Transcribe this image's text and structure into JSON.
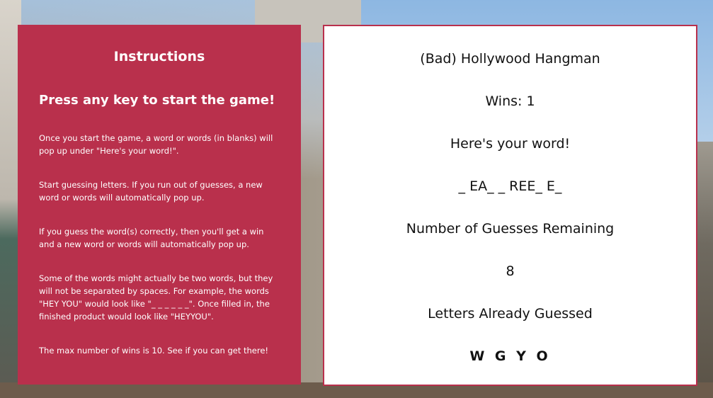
{
  "instructions": {
    "title": "Instructions",
    "start_prompt": "Press any key to start the game!",
    "paragraphs": [
      "Once you start the game, a word or words (in blanks) will pop up under \"Here's your word!\".",
      "Start guessing letters. If you run out of guesses, a new word or words will automatically pop up.",
      "If you guess the word(s) correctly, then you'll get a win and a new word or words will automatically pop up.",
      "Some of the words might actually be two words, but they will not be separated by spaces. For example, the words \"HEY YOU\" would look like \"_ _ _ _ _ _\". Once filled in, the finished product would look like \"HEYYOU\".",
      "The max number of wins is 10. See if you can get there!"
    ]
  },
  "game": {
    "title": "(Bad) Hollywood Hangman",
    "wins_text": "Wins: 1",
    "word_heading": "Here's your word!",
    "word_display": "_ EA_ _ REE_ E_",
    "guesses_heading": "Number of Guesses Remaining",
    "guesses_remaining": "8",
    "letters_heading": "Letters Already Guessed",
    "letters_guessed": "W G Y O"
  },
  "colors": {
    "instructions_panel": "#b9304c",
    "game_panel": "#ffffff",
    "game_border": "#b9304c"
  }
}
